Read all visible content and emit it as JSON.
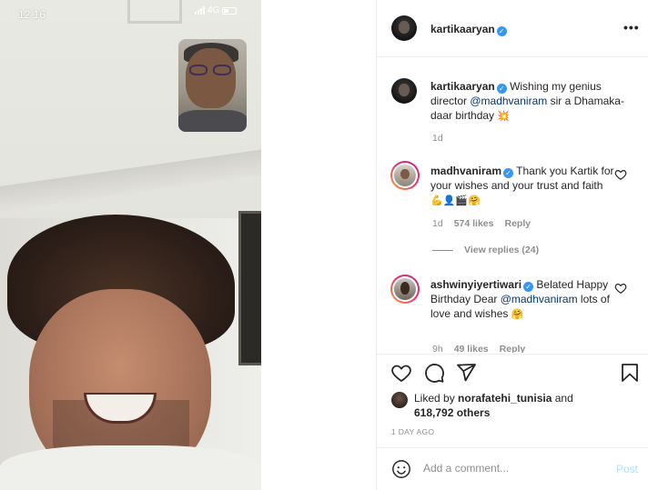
{
  "phone": {
    "time": "12:16",
    "network": "4G"
  },
  "post": {
    "author": "kartikaaryan",
    "more_label": "•••",
    "caption": {
      "username": "kartikaaryan",
      "text_before": "Wishing my genius director ",
      "mention": "@madhvaniram",
      "text_after": " sir a Dhamaka-daar birthday ",
      "emoji": "💥",
      "time": "1d"
    },
    "comments": [
      {
        "username": "madhvaniram",
        "text": "Thank you Kartik for your wishes and your trust and faith ",
        "emoji": "💪👤🎬🤗",
        "time": "1d",
        "likes": "574 likes",
        "reply": "Reply",
        "view_replies": "View replies (24)"
      },
      {
        "username": "ashwinyiyertiwari",
        "text_before": "Belated Happy Birthday Dear ",
        "mention": "@madhvaniram",
        "text_after": " lots of love and wishes ",
        "emoji": "🤗",
        "time": "9h",
        "likes": "49 likes",
        "reply": "Reply"
      }
    ],
    "liked_by_prefix": "Liked by ",
    "liked_by_user": "norafatehi_tunisia",
    "liked_by_and": " and",
    "liked_by_count": "618,792 others",
    "date": "1 DAY AGO",
    "comment_placeholder": "Add a comment...",
    "post_label": "Post"
  },
  "colors": {
    "verified": "#3897f0",
    "mention": "#00376b",
    "meta": "#8e8e8e",
    "post_disabled": "#b2dffc"
  }
}
